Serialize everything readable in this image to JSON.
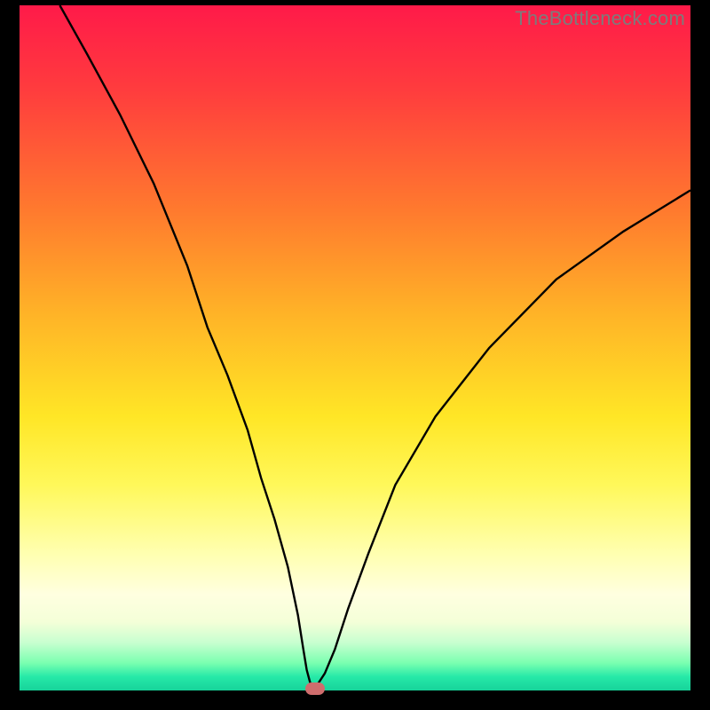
{
  "watermark": {
    "text": "TheBottleneck.com"
  },
  "colors": {
    "curve_stroke": "#000000",
    "marker_fill": "#cf6d6d",
    "frame": "#000000"
  },
  "chart_data": {
    "type": "line",
    "title": "",
    "xlabel": "",
    "ylabel": "",
    "xlim": [
      0,
      100
    ],
    "ylim": [
      0,
      100
    ],
    "grid": false,
    "legend": false,
    "series": [
      {
        "name": "curve",
        "x": [
          6,
          10,
          15,
          20,
          25,
          28,
          31,
          34,
          36,
          38,
          40,
          41.5,
          42.3,
          42.8,
          43.3,
          43.8,
          44.5,
          45.5,
          47,
          49,
          52,
          56,
          62,
          70,
          80,
          90,
          100
        ],
        "y": [
          100,
          93,
          84,
          74,
          62,
          53,
          46,
          38,
          31,
          25,
          18,
          11,
          6,
          3,
          1.2,
          0.4,
          1.0,
          2.5,
          6,
          12,
          20,
          30,
          40,
          50,
          60,
          67,
          73
        ]
      }
    ],
    "marker": {
      "x": 44,
      "y": 0.3
    },
    "note": "x and y are in percent of plot width/height; values estimated from pixel positions."
  }
}
